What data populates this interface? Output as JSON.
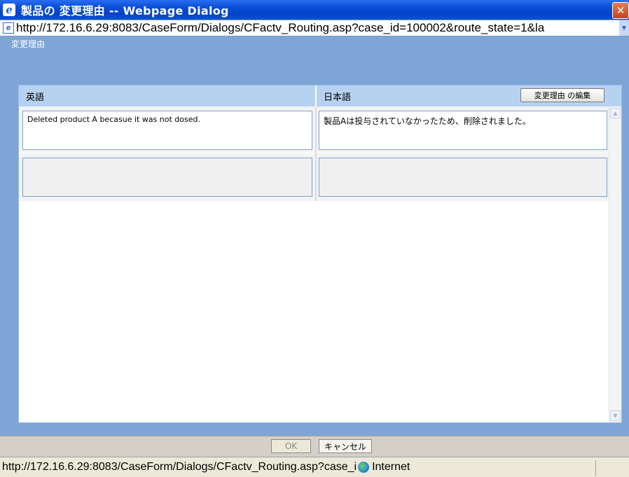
{
  "window": {
    "title": "製品の 変更理由 -- Webpage Dialog",
    "close_glyph": "✕"
  },
  "address_bar": {
    "url": "http://172.16.6.29:8083/CaseForm/Dialogs/CFactv_Routing.asp?case_id=100002&route_state=1&la"
  },
  "page": {
    "header_label": "変更理由"
  },
  "table": {
    "columns": [
      {
        "label": "英語"
      },
      {
        "label": "日本語"
      }
    ],
    "edit_button_label": "変更理由 の編集",
    "rows": [
      {
        "english": "Deleted product A becasue it was not dosed.",
        "japanese": "製品Aは投与されていなかったため、削除されました。"
      },
      {
        "english": "",
        "japanese": ""
      }
    ]
  },
  "buttons": {
    "ok_label": "OK",
    "cancel_label": "キャンセル"
  },
  "status_bar": {
    "url": "http://172.16.6.29:8083/CaseForm/Dialogs/CFactv_Routing.asp?case_i",
    "zone": "Internet"
  },
  "icons": {
    "browser": "ie-icon",
    "page": "page-icon",
    "zone": "globe-icon"
  }
}
